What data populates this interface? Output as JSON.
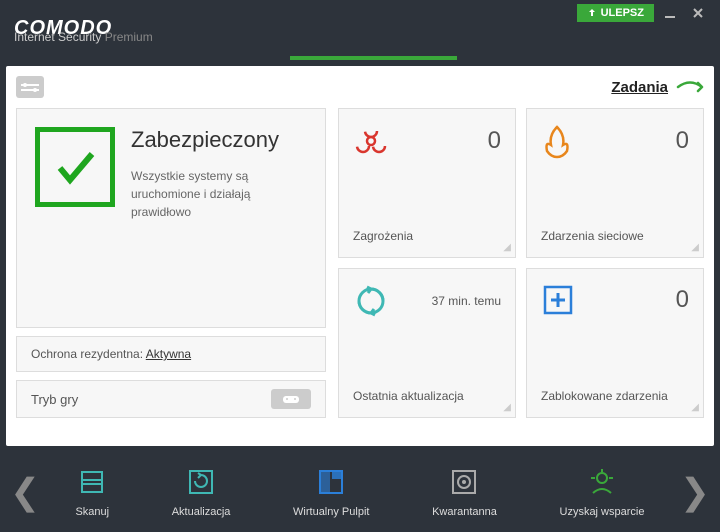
{
  "brand": "COMODO",
  "product_line": "Internet Security",
  "product_edition": "Premium",
  "upgrade_label": "ULEPSZ",
  "status_banner": "Zabezpieczony",
  "tasks_link": "Zadania",
  "main": {
    "title": "Zabezpieczony",
    "subtitle": "Wszystkie systemy są uruchomione i działają prawidłowo"
  },
  "resident": {
    "label": "Ochrona rezydentna:",
    "value": "Aktywna"
  },
  "game_mode_label": "Tryb gry",
  "tiles": {
    "threats": {
      "count": "0",
      "label": "Zagrożenia"
    },
    "network": {
      "count": "0",
      "label": "Zdarzenia sieciowe"
    },
    "update": {
      "time": "37 min. temu",
      "label": "Ostatnia aktualizacja"
    },
    "blocked": {
      "count": "0",
      "label": "Zablokowane zdarzenia"
    }
  },
  "actions": {
    "scan": "Skanuj",
    "update": "Aktualizacja",
    "virtual": "Wirtualny Pulpit",
    "quarantine": "Kwarantanna",
    "support": "Uzyskaj wsparcie"
  },
  "colors": {
    "green": "#3aa83a",
    "red": "#d9362e",
    "orange": "#e8861c",
    "cyan": "#3fb8b4",
    "blue": "#2b7fd9"
  }
}
